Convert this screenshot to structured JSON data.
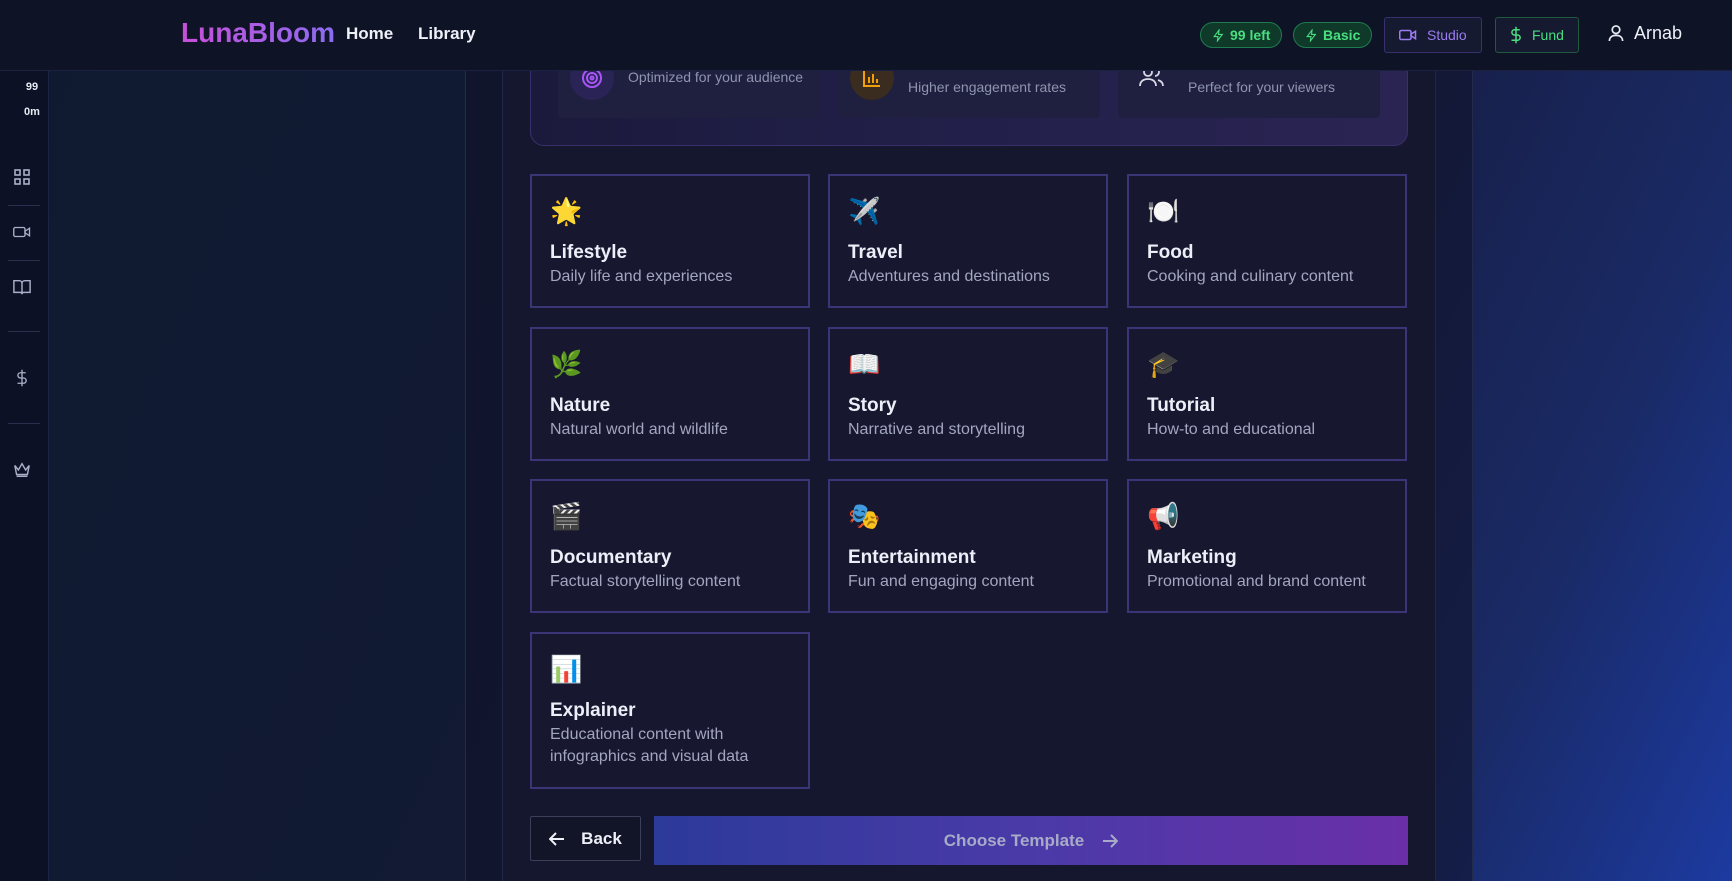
{
  "app": {
    "name": "LunaBloom",
    "nav": [
      {
        "label": "Home"
      },
      {
        "label": "Library"
      }
    ],
    "credits_pill": "99 left",
    "plan_pill": "Basic",
    "studio_label": "Studio",
    "fund_label": "Fund",
    "user_name": "Arnab"
  },
  "sidebar": {
    "count": "99",
    "time": "0m",
    "icons": [
      "dashboard-icon",
      "video-icon",
      "book-icon",
      "dollar-icon",
      "crown-icon"
    ]
  },
  "benefits": [
    {
      "text": "Optimized for your audience",
      "icon": "target-icon"
    },
    {
      "text": "Higher engagement rates",
      "icon": "chart-icon"
    },
    {
      "text": "Perfect for your viewers",
      "icon": "users-icon"
    }
  ],
  "categories": [
    {
      "emoji": "🌟",
      "title": "Lifestyle",
      "desc": "Daily life and experiences"
    },
    {
      "emoji": "✈️",
      "title": "Travel",
      "desc": "Adventures and destinations"
    },
    {
      "emoji": "🍽️",
      "title": "Food",
      "desc": "Cooking and culinary content"
    },
    {
      "emoji": "🌿",
      "title": "Nature",
      "desc": "Natural world and wildlife"
    },
    {
      "emoji": "📖",
      "title": "Story",
      "desc": "Narrative and storytelling"
    },
    {
      "emoji": "🎓",
      "title": "Tutorial",
      "desc": "How-to and educational"
    },
    {
      "emoji": "🎬",
      "title": "Documentary",
      "desc": "Factual storytelling content"
    },
    {
      "emoji": "🎭",
      "title": "Entertainment",
      "desc": "Fun and engaging content"
    },
    {
      "emoji": "📢",
      "title": "Marketing",
      "desc": "Promotional and brand content"
    },
    {
      "emoji": "📊",
      "title": "Explainer",
      "desc": "Educational content with infographics and visual data"
    }
  ],
  "actions": {
    "back_label": "Back",
    "choose_label": "Choose Template"
  },
  "colors": {
    "accent_green": "#4ade80",
    "card_border": "#3a3577",
    "studio_purple": "#9b7cf0"
  }
}
